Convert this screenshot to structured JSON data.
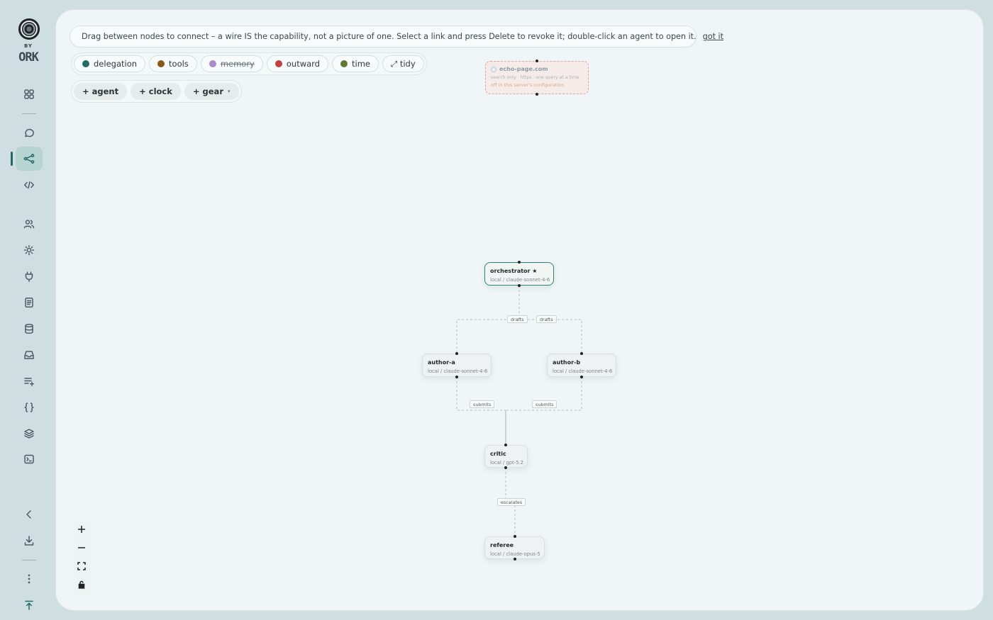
{
  "brand": {
    "by": "BY",
    "word": "ORK"
  },
  "sidebar": {
    "items": [
      {
        "name": "dashboard",
        "icon": "grid-icon"
      },
      {
        "name": "chat",
        "icon": "chat-bubble-icon"
      },
      {
        "name": "graph",
        "icon": "share-nodes-icon",
        "active": true
      },
      {
        "name": "code",
        "icon": "code-icon"
      },
      {
        "name": "users",
        "icon": "users-icon"
      },
      {
        "name": "settings",
        "icon": "sun-gear-icon"
      },
      {
        "name": "plugins",
        "icon": "plug-icon"
      },
      {
        "name": "docs",
        "icon": "document-icon"
      },
      {
        "name": "database",
        "icon": "database-icon"
      },
      {
        "name": "inbox",
        "icon": "inbox-icon"
      },
      {
        "name": "queue",
        "icon": "list-add-icon"
      },
      {
        "name": "json",
        "icon": "braces-icon"
      },
      {
        "name": "layers",
        "icon": "layers-icon"
      },
      {
        "name": "terminal",
        "icon": "terminal-icon"
      },
      {
        "name": "collapse",
        "icon": "chevron-left-icon"
      },
      {
        "name": "download",
        "icon": "download-icon"
      },
      {
        "name": "more",
        "icon": "more-vertical-icon"
      },
      {
        "name": "top",
        "icon": "arrow-to-top-icon"
      }
    ]
  },
  "hint": {
    "text": "Drag between nodes to connect – a wire IS the capability, not a picture of one. Select a link and press Delete to revoke it; double-click an agent to open it.",
    "dismiss": "got it"
  },
  "legend": [
    {
      "label": "delegation",
      "color": "#1f6b66",
      "struck": false
    },
    {
      "label": "tools",
      "color": "#8a5a12",
      "struck": false
    },
    {
      "label": "memory",
      "color": "#a98bd0",
      "struck": true
    },
    {
      "label": "outward",
      "color": "#c2413f",
      "struck": false
    },
    {
      "label": "time",
      "color": "#5e7a2e",
      "struck": false
    }
  ],
  "tidy_label": "⤢ tidy",
  "add_buttons": [
    {
      "label": "+ agent"
    },
    {
      "label": "+ clock"
    },
    {
      "label": "+ gear",
      "caret": "▾"
    }
  ],
  "echo_node": {
    "title": "echo-page.com",
    "subtitle": "search only · https · one query at a time",
    "status": "off in this server's configuration"
  },
  "nodes": {
    "orchestrator": {
      "name": "orchestrator ★",
      "model": "local / claude-sonnet-4-6"
    },
    "author_a": {
      "name": "author-a",
      "model": "local / claude-sonnet-4-6"
    },
    "author_b": {
      "name": "author-b",
      "model": "local / claude-sonnet-4-6"
    },
    "critic": {
      "name": "critic",
      "model": "local / gpt-5.2"
    },
    "referee": {
      "name": "referee",
      "model": "local / claude-opus-5"
    }
  },
  "edges": {
    "drafts_a": "drafts",
    "drafts_b": "drafts",
    "submits_a": "submits",
    "submits_b": "submits",
    "escalates": "escalates"
  },
  "zoom_controls": [
    {
      "name": "zoom-in",
      "icon": "plus-icon"
    },
    {
      "name": "zoom-out",
      "icon": "minus-icon"
    },
    {
      "name": "fit-view",
      "icon": "fit-view-icon"
    },
    {
      "name": "lock",
      "icon": "lock-icon"
    }
  ]
}
